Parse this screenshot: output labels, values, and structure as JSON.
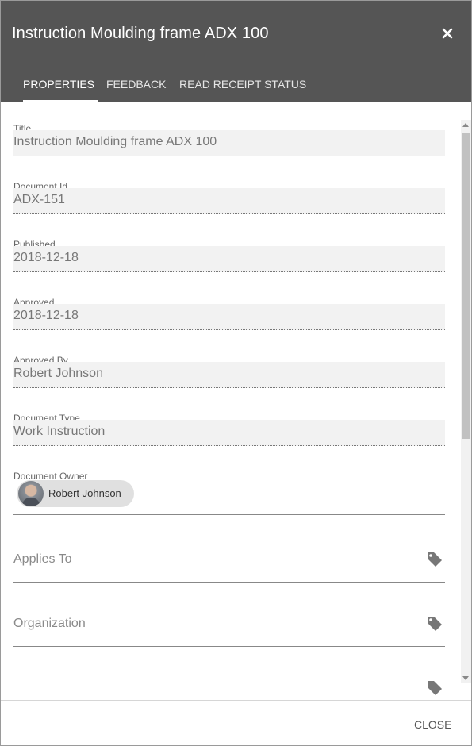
{
  "dialog": {
    "title": "Instruction Moulding frame ADX 100",
    "close_icon": "close-icon",
    "footer_close_label": "CLOSE"
  },
  "tabs": [
    {
      "label": "PROPERTIES",
      "active": true
    },
    {
      "label": "FEEDBACK",
      "active": false
    },
    {
      "label": "READ RECEIPT STATUS",
      "active": false
    }
  ],
  "fields": [
    {
      "label": "Title",
      "value": "Instruction Moulding frame ADX 100"
    },
    {
      "label": "Document Id",
      "value": "ADX-151"
    },
    {
      "label": "Published",
      "value": "2018-12-18"
    },
    {
      "label": "Approved",
      "value": "2018-12-18"
    },
    {
      "label": "Approved By",
      "value": "Robert Johnson"
    },
    {
      "label": "Document Type",
      "value": "Work Instruction"
    }
  ],
  "owner": {
    "label": "Document Owner",
    "name": "Robert Johnson"
  },
  "pickers": [
    {
      "label": "Applies To",
      "icon": "tag-icon"
    },
    {
      "label": "Organization",
      "icon": "tag-icon"
    }
  ],
  "colors": {
    "header_bg": "#555555",
    "field_bg": "#f2f2f2",
    "chip_bg": "#e0e0e0"
  }
}
